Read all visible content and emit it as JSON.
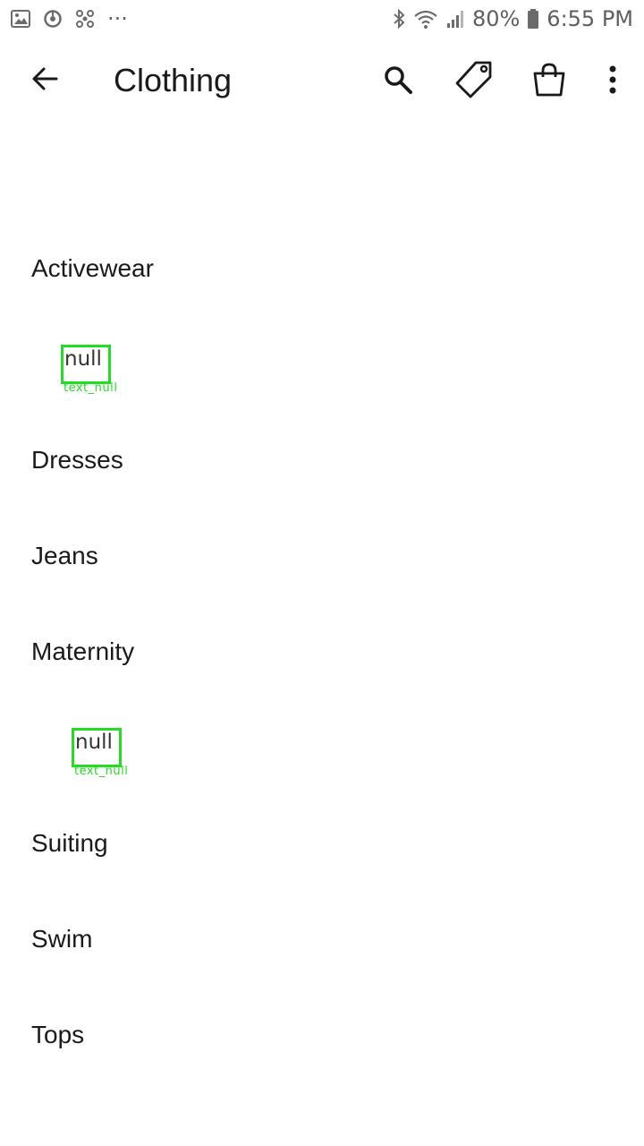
{
  "status_bar": {
    "battery_text": "80%",
    "time": "6:55 PM",
    "dots": "···",
    "icons": [
      "gallery-icon",
      "sync-icon",
      "fan-icon",
      "bluetooth-icon",
      "wifi-icon",
      "signal-icon",
      "battery-icon"
    ]
  },
  "header": {
    "title": "Clothing",
    "icons": [
      "back-arrow-icon",
      "search-icon",
      "tag-icon",
      "shopping-bag-icon",
      "more-vert-icon"
    ]
  },
  "categories": [
    "Activewear",
    "Dresses",
    "Jeans",
    "Maternity",
    "Suiting",
    "Swim",
    "Tops"
  ],
  "overlays": [
    {
      "text": "null",
      "caption": "text_null"
    },
    {
      "text": "null",
      "caption": "text_null"
    }
  ],
  "colors": {
    "overlay": "#22dd22",
    "text": "#1a1a1a",
    "status": "#5f5f5f"
  }
}
